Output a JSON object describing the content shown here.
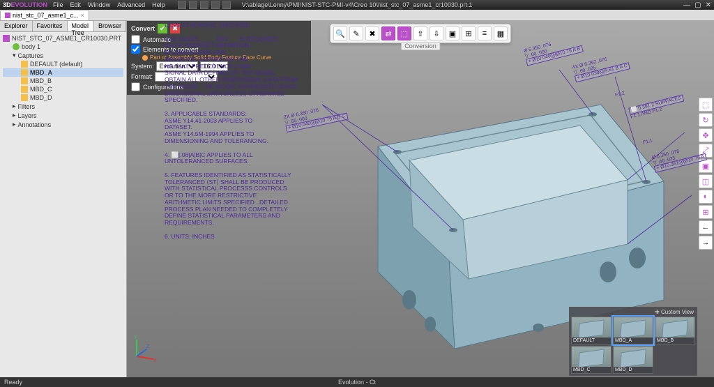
{
  "title_path": "V:\\ablage\\Lenny\\PMI\\NIST-STC-PMI-v4\\Creo 10\\nist_stc_07_asme1_cr10030.prt.1",
  "app_name": "3D EVOLUTION",
  "menu": [
    "File",
    "Edit",
    "Window",
    "Advanced",
    "Help"
  ],
  "doc_tab": "nist_stc_07_asme1_c...",
  "left_tabs": [
    "Explorer",
    "Favorites",
    "Model Tree",
    "Browser"
  ],
  "tree": {
    "root": "NIST_STC_07_ASME1_CR10030.PRT",
    "body": "body 1",
    "captures": "Captures",
    "items": [
      "DEFAULT (default)",
      "MBD_A",
      "MBD_B",
      "MBD_C",
      "MBD_D"
    ],
    "filters": "Filters",
    "layers": "Layers",
    "annotations": "Annotations"
  },
  "convert": {
    "title": "Convert",
    "automatic": "Automatic",
    "elements": "Elements to convert",
    "tags": "Part or Assembly Solid Body Feature Face Curve",
    "system_label": "System:",
    "system_value": "Evolution",
    "version_value": "16.0",
    "format_label": "Format:",
    "configs": "Configurations"
  },
  "notes": "LESS OTHERWISE SPECIFIED:\n\n      CAD MODEL ____ REV. __ IS REQUIRED\n      ELETE PRODUCT DEFINITION.\n      ED DIMENSIONS AND\n      MENSIONS DEFINED ON THE\n      NG TAKE PRECEDENCE OVER\n      SIONAL DATA DEFINED BY THE MODEL.\n      OBTAIN ALL OTHER DIMENSIONAL DATA FROM\n      THE MODEL. THE MODEL REPRESENTS BASIC\n      DIMENSIONAL DATA UNLESS OTHERWISE\n      SPECIFIED.\n\n3.  APPLICABLE STANDARDS:\n      ASME Y14.41-2003 APPLIES TO\n      DATASET.\n      ASME Y14.5M-1994 APPLIES TO\n      DIMENSIONING AND TOLERANCING.\n\n4.  ⬜[.06]A|B|C APPLIES TO ALL\n      UNTOLERANCED SURFACES.\n\n5.  FEATURES IDENTIFIED AS STATISTICALLY\n      TOLERANCED ⟨ST⟩ SHALL BE PRODUCED\n      WITH STATISTICAL PROCESSS CONTROLS\n      OR TO THE MORE RESTRICTIVE\n      ARITHMETIC LIMITS SPECIFIED . DETAILED\n      PROCESS PLAN NEEDED TO COMPLETELY\n      DEFINE STATISTICAL PARAMETERS AND\n      REQUIREMENTS.\n\n6.  UNITS: INCHES",
  "float_label": "Conversion",
  "annotations": {
    "a1_line1": "Ø 6.350 .076",
    "a1_line2": "▽ .60   .000",
    "a1_line3": "⌖ Ø10.040Ⓜ|Ø10.79 A B",
    "a2_line1": "4X Ø 6.352 .076",
    "a2_line2": "▽ .60   .025",
    "a2_line3": "⌖ Ø10.038Ⓜ|9.61 B A C",
    "a3_line1": "2X Ø 6.350 .076",
    "a3_line2": "▽ .60   .000",
    "a3_line3": "⌖ Ø10.040Ⓜ|Ø10.79 A B C",
    "f11": "F1.1",
    "f12": "F1.2",
    "surf_line1": "⬜ 0.381 2 SURFACES",
    "surf_line2": "F1.1 AND F1.2",
    "a4_line1": "Ø 6.350 .076",
    "a4_line2": "▽ .60   .025",
    "a4_line3": "⌖ Ø10.361Ⓜ|Ø10.79 A"
  },
  "axes": {
    "x": "X",
    "y": "Y",
    "z": "Z"
  },
  "views": {
    "header": "Custom View",
    "items": [
      "DEFAULT",
      "MBD_A",
      "MBD_B",
      "MBD_C",
      "MBD_D"
    ]
  },
  "status": {
    "left": "Ready",
    "center": "Evolution - Ct"
  },
  "icons": {
    "search": "🔍",
    "edit": "✎",
    "tools": "✖",
    "convert": "⇄",
    "model": "⬚",
    "up": "⇧",
    "down": "⇩",
    "frame": "▣",
    "grid": "⊞",
    "list": "≡",
    "box": "▦"
  }
}
